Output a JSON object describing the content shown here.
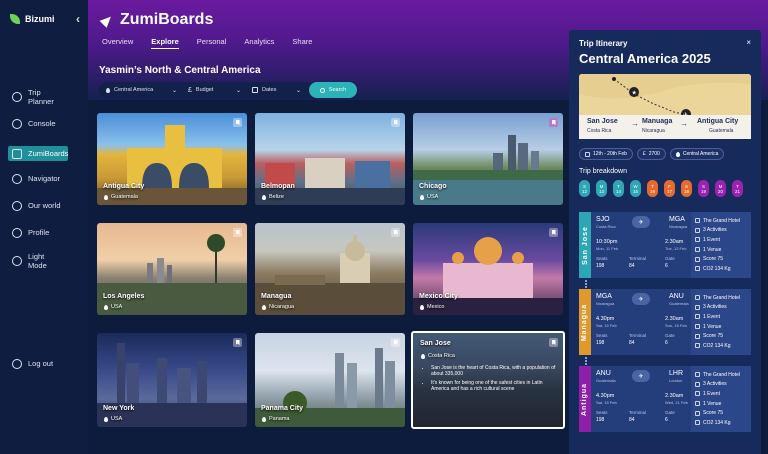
{
  "brand": {
    "name": "Bizumi"
  },
  "nav": [
    {
      "label": "Trip Planner",
      "icon": "plus-circle-icon"
    },
    {
      "label": "Console",
      "icon": "people-icon"
    },
    {
      "label": "ZumiBoards",
      "icon": "board-icon",
      "active": true
    },
    {
      "label": "Navigator",
      "icon": "map-icon"
    },
    {
      "label": "Our world",
      "icon": "globe-icon"
    },
    {
      "label": "Profile",
      "icon": "person-icon"
    },
    {
      "label": "Light Mode",
      "icon": "sun-icon"
    }
  ],
  "logout": {
    "label": "Log out"
  },
  "header": {
    "title": "ZumiBoards",
    "tabs": [
      "Overview",
      "Explore",
      "Personal",
      "Analytics",
      "Share"
    ],
    "active_tab": "Explore"
  },
  "board": {
    "title": "Yasmin’s North & Central America"
  },
  "search": {
    "region": "Central America",
    "budget": "Budget",
    "dates": "Dates",
    "button": "Search"
  },
  "cards": [
    {
      "title": "Antigua City",
      "country": "Guatemala"
    },
    {
      "title": "Belmopan",
      "country": "Belize"
    },
    {
      "title": "Chicago",
      "country": "USA"
    },
    {
      "title": "Los Angeles",
      "country": "USA"
    },
    {
      "title": "Managua",
      "country": "Nicaragua"
    },
    {
      "title": "Mexico City",
      "country": "Mexico"
    },
    {
      "title": "New York",
      "country": "USA"
    },
    {
      "title": "Panama City",
      "country": "Panama"
    },
    {
      "title": "San Jose",
      "country": "Costa Rica",
      "bullets": [
        "San Jose is the heart of Costa Rica, with a population of about 335,000",
        "It's known for being one of the safest cities in Latin America and has a rich cultural scene"
      ]
    }
  ],
  "itinerary": {
    "label": "Trip Itinerary",
    "close": "×",
    "title": "Central America 2025",
    "route": [
      {
        "city": "San Jose",
        "country": "Costa Rica"
      },
      {
        "city": "Manuaga",
        "country": "Nicaragua"
      },
      {
        "city": "Antigua City",
        "country": "Guatemala"
      }
    ],
    "arrow": "→",
    "chips": [
      "12th - 20th Feb",
      "2700",
      "Central America"
    ],
    "breakdown_label": "Trip breakdown",
    "days": [
      {
        "d": "S",
        "n": "12",
        "color": "#2ea7b5"
      },
      {
        "d": "M",
        "n": "13",
        "color": "#2ea7b5"
      },
      {
        "d": "T",
        "n": "14",
        "color": "#2ea7b5"
      },
      {
        "d": "W",
        "n": "15",
        "color": "#2ea7b5"
      },
      {
        "d": "T",
        "n": "16",
        "color": "#e66a2c"
      },
      {
        "d": "F",
        "n": "17",
        "color": "#e66a2c"
      },
      {
        "d": "S",
        "n": "18",
        "color": "#e66a2c"
      },
      {
        "d": "S",
        "n": "19",
        "color": "#9b23b0"
      },
      {
        "d": "M",
        "n": "20",
        "color": "#9b23b0"
      },
      {
        "d": "T",
        "n": "21",
        "color": "#9b23b0"
      }
    ],
    "segments": [
      {
        "band": "San Jose",
        "color": "#2ea7b5",
        "from": "SJO",
        "from_name": "Costa Rica",
        "to": "MGA",
        "to_name": "Nicaragua",
        "dep": "10:30pm",
        "dep_date": "Mon, 11 Feb",
        "arr": "2.30am",
        "arr_date": "Tue, 12 Feb",
        "seats": "198",
        "terminal": "84",
        "gate": "6",
        "side": [
          "The Grand Hotel",
          "3 Activities",
          "1 Event",
          "1 Venue",
          "Score 75",
          "CO2 134 Kg"
        ]
      },
      {
        "band": "Managua",
        "color": "#e09a2c",
        "from": "MGA",
        "from_name": "Nicaragua",
        "to": "ANU",
        "to_name": "Guatemala",
        "dep": "4.30pm",
        "dep_date": "Sat, 15 Feb",
        "arr": "2.30am",
        "arr_date": "Sun, 16 Feb",
        "seats": "198",
        "terminal": "84",
        "gate": "6",
        "side": [
          "The Grand Hotel",
          "3 Activities",
          "1 Event",
          "1 Venue",
          "Score 75",
          "CO2 134 Kg"
        ]
      },
      {
        "band": "Antigua",
        "color": "#8f1fa8",
        "from": "ANU",
        "from_name": "Guatemala",
        "to": "LHR",
        "to_name": "London",
        "dep": "4.30pm",
        "dep_date": "Sat, 15 Feb",
        "arr": "2.30am",
        "arr_date": "Wed, 21 Feb",
        "seats": "198",
        "terminal": "84",
        "gate": "6",
        "side": [
          "The Grand Hotel",
          "3 Activities",
          "1 Event",
          "1 Venue",
          "Score 75",
          "CO2 134 Kg"
        ]
      }
    ],
    "labels": {
      "seats": "Seats",
      "terminal": "Terminal",
      "gate": "Gate"
    }
  }
}
